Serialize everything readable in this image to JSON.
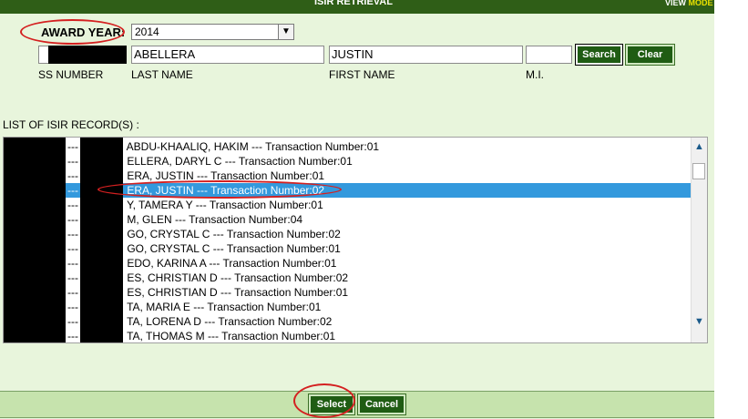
{
  "header": {
    "title": "ISIR RETRIEVAL",
    "view_mode_prefix": "VIEW ",
    "view_mode_suffix": "MODE"
  },
  "form": {
    "award_year_label": "AWARD YEAR:",
    "award_year_value": "2014",
    "ssn_value": "",
    "last_name_value": "ABELLERA",
    "first_name_value": "JUSTIN",
    "mi_value": "",
    "search_label": "Search",
    "clear_label": "Clear",
    "ssn_caption": "SS NUMBER",
    "last_name_caption": "LAST NAME",
    "first_name_caption": "FIRST NAME",
    "mi_caption": "M.I."
  },
  "list": {
    "title": "LIST OF ISIR RECORD(S)  :",
    "selected_index": 3,
    "rows": [
      "---                ABDU-KHAALIQ, HAKIM --- Transaction Number:01",
      "---                ELLERA, DARYL C --- Transaction Number:01",
      "---                ERA, JUSTIN --- Transaction Number:01",
      "---                ERA, JUSTIN --- Transaction Number:02",
      "---                Y, TAMERA Y --- Transaction Number:01",
      "---                M, GLEN --- Transaction Number:04",
      "---                GO, CRYSTAL C --- Transaction Number:02",
      "---                GO, CRYSTAL C --- Transaction Number:01",
      "---                EDO, KARINA A --- Transaction Number:01",
      "---                ES, CHRISTIAN D --- Transaction Number:02",
      "---                ES, CHRISTIAN D --- Transaction Number:01",
      "---                TA, MARIA E --- Transaction Number:01",
      "---                TA, LORENA D --- Transaction Number:02",
      "---                TA, THOMAS M --- Transaction Number:01"
    ]
  },
  "footer": {
    "select_label": "Select",
    "cancel_label": "Cancel"
  },
  "colors": {
    "brand_green": "#1f5c13",
    "panel_bg": "#e8f5dc",
    "selection": "#3399dd",
    "annotation_red": "#d42020"
  }
}
